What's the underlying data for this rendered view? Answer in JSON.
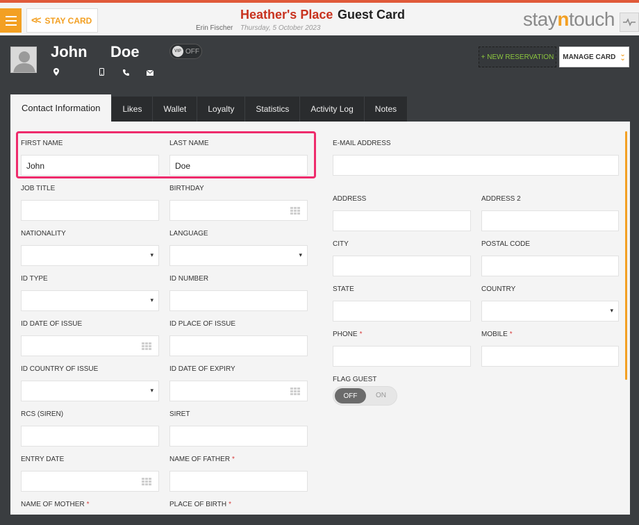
{
  "header": {
    "menu_icon": "hamburger-icon",
    "stay_card_label": "STAY CARD",
    "hotel_name": "Heather's Place",
    "card_title": "Guest Card",
    "user_name": "Erin Fischer",
    "date": "Thursday, 5 October 2023",
    "brand": {
      "part1": "stay",
      "part2": "n",
      "part3": "touch"
    },
    "accent_color": "#f3a023",
    "title_color": "#c8321e"
  },
  "guest": {
    "first_name": "John",
    "last_name": "Doe",
    "vip_badge": "VIP",
    "vip_state": "OFF",
    "icons": [
      "location-icon",
      "mobile-icon",
      "phone-icon",
      "email-icon"
    ],
    "new_reservation_label": "+ NEW RESERVATION",
    "manage_card_label": "MANAGE CARD"
  },
  "tabs": [
    {
      "label": "Contact Information",
      "active": true
    },
    {
      "label": "Likes"
    },
    {
      "label": "Wallet"
    },
    {
      "label": "Loyalty"
    },
    {
      "label": "Statistics"
    },
    {
      "label": "Activity Log"
    },
    {
      "label": "Notes"
    }
  ],
  "form": {
    "first_name": {
      "label": "FIRST NAME",
      "value": "John"
    },
    "last_name": {
      "label": "LAST NAME",
      "value": "Doe"
    },
    "job_title": {
      "label": "JOB TITLE",
      "value": ""
    },
    "birthday": {
      "label": "BIRTHDAY",
      "value": ""
    },
    "nationality": {
      "label": "NATIONALITY",
      "value": ""
    },
    "language": {
      "label": "LANGUAGE",
      "value": ""
    },
    "id_type": {
      "label": "ID TYPE",
      "value": ""
    },
    "id_number": {
      "label": "ID NUMBER",
      "value": ""
    },
    "id_date_of_issue": {
      "label": "ID DATE OF ISSUE",
      "value": ""
    },
    "id_place_of_issue": {
      "label": "ID PLACE OF ISSUE",
      "value": ""
    },
    "id_country_of_issue": {
      "label": "ID COUNTRY OF ISSUE",
      "value": ""
    },
    "id_date_of_expiry": {
      "label": "ID DATE OF EXPIRY",
      "value": ""
    },
    "rcs_siren": {
      "label": "RCS (SIREN)",
      "value": ""
    },
    "siret": {
      "label": "SIRET",
      "value": ""
    },
    "entry_date": {
      "label": "ENTRY DATE",
      "value": ""
    },
    "name_of_father": {
      "label": "NAME OF FATHER",
      "value": ""
    },
    "name_of_mother": {
      "label": "NAME OF MOTHER",
      "value": ""
    },
    "place_of_birth": {
      "label": "PLACE OF BIRTH",
      "value": ""
    },
    "email": {
      "label": "E-MAIL ADDRESS",
      "value": ""
    },
    "address": {
      "label": "ADDRESS",
      "value": ""
    },
    "address2": {
      "label": "ADDRESS 2",
      "value": ""
    },
    "city": {
      "label": "CITY",
      "value": ""
    },
    "postal_code": {
      "label": "POSTAL CODE",
      "value": ""
    },
    "state": {
      "label": "STATE",
      "value": ""
    },
    "country": {
      "label": "COUNTRY",
      "value": ""
    },
    "phone": {
      "label": "PHONE",
      "value": ""
    },
    "mobile": {
      "label": "MOBILE",
      "value": ""
    },
    "flag_guest": {
      "label": "FLAG GUEST",
      "off_label": "OFF",
      "on_label": "ON",
      "state": "OFF"
    },
    "required_mark": "*",
    "highlight_color": "#ee2b6c"
  }
}
